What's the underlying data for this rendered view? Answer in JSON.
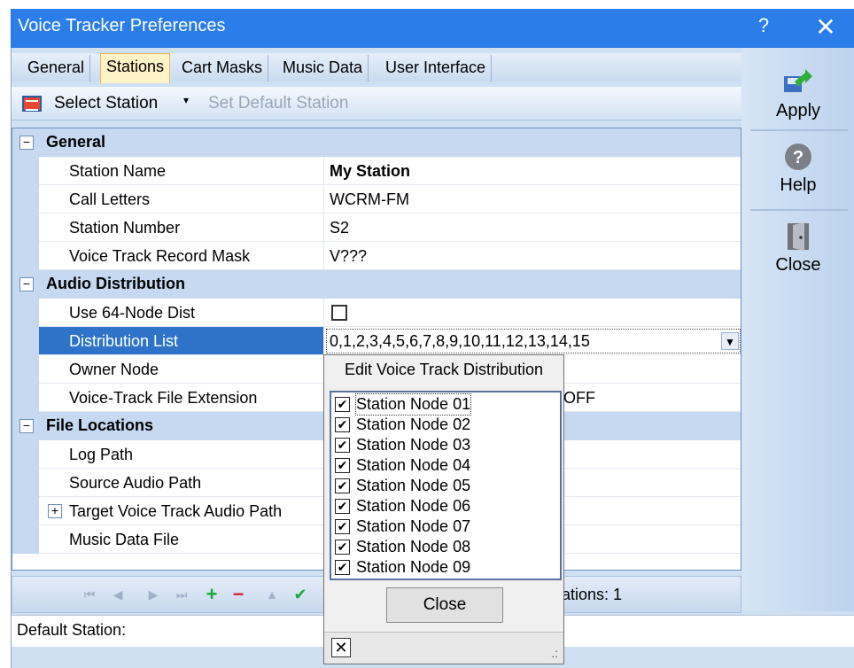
{
  "window": {
    "title": "Voice Tracker Preferences",
    "help_glyph": "?",
    "close_glyph": "✕"
  },
  "tabs": [
    "General",
    "Stations",
    "Cart Masks",
    "Music Data",
    "User Interface"
  ],
  "toolbar": {
    "select_station": "Select Station",
    "caret": "▾",
    "set_default": "Set Default Station"
  },
  "grid": {
    "general": {
      "label": "General",
      "expander": "−",
      "station_name": {
        "name": "Station Name",
        "value": "My Station"
      },
      "call_letters": {
        "name": "Call Letters",
        "value": "WCRM-FM"
      },
      "station_number": {
        "name": "Station Number",
        "value": "S2"
      },
      "record_mask": {
        "name": "Voice Track Record Mask",
        "value": "V???"
      }
    },
    "audio": {
      "label": "Audio Distribution",
      "expander": "−",
      "use64": {
        "name": "Use 64-Node Dist",
        "checked": false
      },
      "dist_list": {
        "name": "Distribution List",
        "value": "0,1,2,3,4,5,6,7,8,9,10,11,12,13,14,15"
      },
      "owner_node": {
        "name": "Owner Node",
        "value": ""
      },
      "file_ext": {
        "name": "Voice-Track File Extension",
        "value": "OFF"
      }
    },
    "files": {
      "label": "File Locations",
      "expander": "−",
      "log_path": {
        "name": "Log Path"
      },
      "source_audio": {
        "name": "Source Audio Path"
      },
      "target_audio": {
        "name": "Target Voice Track Audio Path",
        "expander": "+"
      },
      "music_data": {
        "name": "Music Data File"
      }
    }
  },
  "navigator": {
    "count_text": "ations: 1"
  },
  "status": {
    "text": "Default Station:"
  },
  "side": {
    "apply": "Apply",
    "help": "Help",
    "close": "Close"
  },
  "popup": {
    "title": "Edit Voice Track Distribution",
    "items": [
      "Station Node 01",
      "Station Node 02",
      "Station Node 03",
      "Station Node 04",
      "Station Node 05",
      "Station Node 06",
      "Station Node 07",
      "Station Node 08",
      "Station Node 09"
    ],
    "close_label": "Close",
    "check_glyph": "✔",
    "x_glyph": "✕",
    "grip_glyph": ".:"
  },
  "colors": {
    "titlebar": "#2b7de9",
    "selection": "#2f73c8",
    "category": "#c6d9f1"
  }
}
